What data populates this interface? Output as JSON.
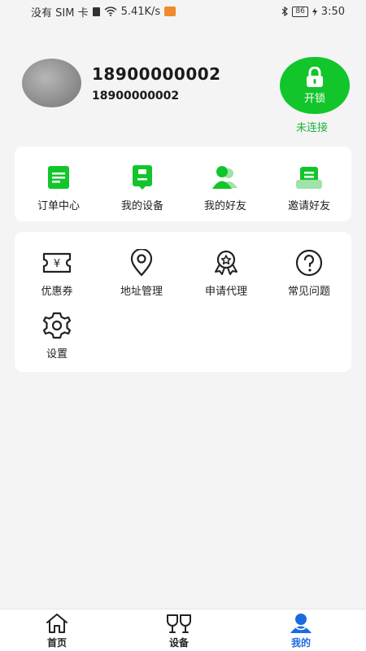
{
  "status_bar": {
    "carrier": "没有 SIM 卡",
    "speed": "5.41K/s",
    "battery": "86",
    "time": "3:50"
  },
  "profile": {
    "name": "18900000002",
    "phone": "18900000002",
    "unlock_label": "开锁",
    "connection_status": "未连接"
  },
  "quick_menu": [
    {
      "label": "订单中心",
      "icon": "order-list-icon"
    },
    {
      "label": "我的设备",
      "icon": "device-icon"
    },
    {
      "label": "我的好友",
      "icon": "friends-icon"
    },
    {
      "label": "邀请好友",
      "icon": "invite-icon"
    }
  ],
  "services": [
    {
      "label": "优惠券",
      "icon": "coupon-icon"
    },
    {
      "label": "地址管理",
      "icon": "location-icon"
    },
    {
      "label": "申请代理",
      "icon": "award-icon"
    },
    {
      "label": "常见问题",
      "icon": "question-icon"
    },
    {
      "label": "设置",
      "icon": "gear-icon"
    }
  ],
  "tab_bar": [
    {
      "label": "首页",
      "icon": "home-icon"
    },
    {
      "label": "设备",
      "icon": "glasses-icon"
    },
    {
      "label": "我的",
      "icon": "user-icon",
      "active": true
    }
  ],
  "colors": {
    "accent_green": "#12c52b",
    "active_tab": "#1a6be0",
    "background": "#f4f4f5"
  }
}
